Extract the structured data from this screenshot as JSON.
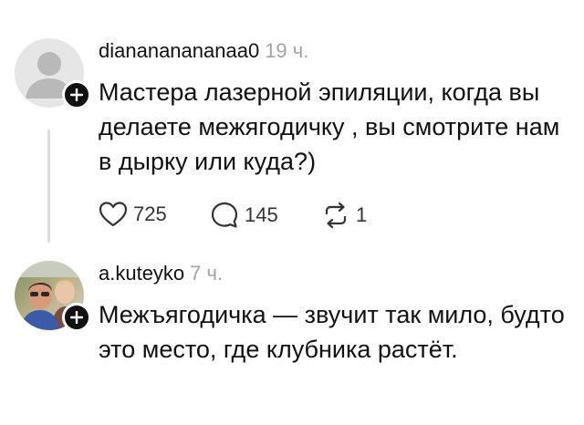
{
  "posts": [
    {
      "username": "dianananananaa0",
      "time": "19 ч.",
      "avatar": "default-user-avatar",
      "text": "Мастера лазерной эпиляции, когда вы делаете межягодичку , вы смотрите нам в дырку или куда?)",
      "actions": {
        "likes": "725",
        "comments": "145",
        "reposts": "1"
      }
    },
    {
      "username": "a.kuteyko",
      "time": "7 ч.",
      "avatar": "profile-photo",
      "text": "Межъягодичка — звучит так мило, будто это место, где клубника растёт."
    }
  ],
  "icons": {
    "follow": "plus-icon",
    "like": "heart-icon",
    "comment": "comment-bubble-icon",
    "repost": "repost-icon"
  },
  "colors": {
    "text": "#111111",
    "muted": "#a3a3a3",
    "thread_line": "#dcdcdc"
  }
}
